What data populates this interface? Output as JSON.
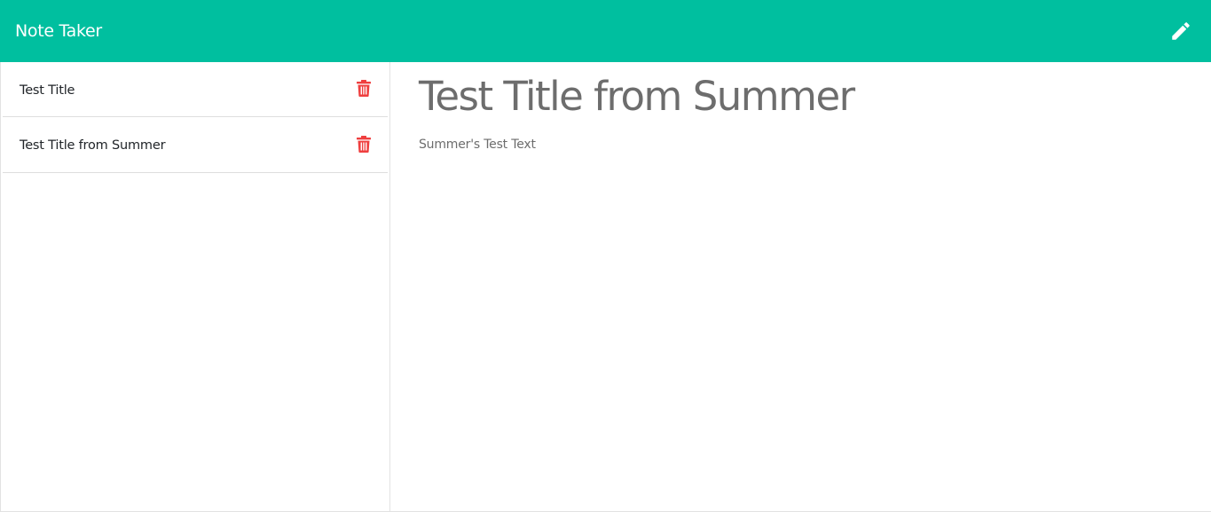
{
  "app": {
    "title": "Note Taker"
  },
  "toolbar": {
    "new_note_icon": "pencil-icon"
  },
  "sidebar": {
    "notes": [
      {
        "title": "Test Title",
        "delete_icon": "trash-icon"
      },
      {
        "title": "Test Title from Summer",
        "delete_icon": "trash-icon"
      }
    ]
  },
  "main": {
    "note_title": "Test Title from Summer",
    "note_text": "Summer's Test Text"
  },
  "colors": {
    "navbar": "#00bf9f",
    "delete": "#ef3f3f",
    "heading": "#6d6d6d"
  }
}
